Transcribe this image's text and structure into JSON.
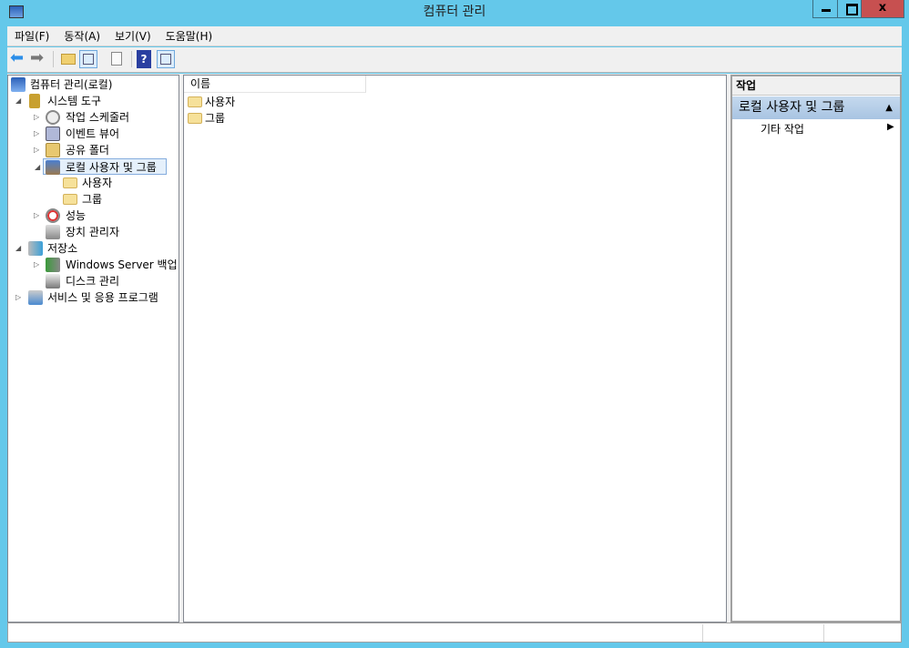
{
  "window": {
    "title": "컴퓨터 관리",
    "close_label": "x"
  },
  "menu": [
    "파일(F)",
    "동작(A)",
    "보기(V)",
    "도움말(H)"
  ],
  "tree": [
    {
      "label": "컴퓨터 관리(로컬)",
      "icon": "computer-management-icon"
    },
    {
      "label": "시스템 도구",
      "icon": "system-tools-icon"
    },
    {
      "label": "작업 스케줄러",
      "icon": "clock-icon"
    },
    {
      "label": "이벤트 뷰어",
      "icon": "event-viewer-icon"
    },
    {
      "label": "공유 폴더",
      "icon": "shared-folder-icon"
    },
    {
      "label": "로컬 사용자 및 그룹",
      "icon": "users-groups-icon"
    },
    {
      "label": "사용자",
      "icon": "folder-icon"
    },
    {
      "label": "그룹",
      "icon": "folder-icon"
    },
    {
      "label": "성능",
      "icon": "performance-icon"
    },
    {
      "label": "장치 관리자",
      "icon": "device-manager-icon"
    },
    {
      "label": "저장소",
      "icon": "storage-icon"
    },
    {
      "label": "Windows Server 백업",
      "icon": "backup-icon"
    },
    {
      "label": "디스크 관리",
      "icon": "disk-icon"
    },
    {
      "label": "서비스 및 응용 프로그램",
      "icon": "services-icon"
    }
  ],
  "list": {
    "column": "이름",
    "items": [
      "사용자",
      "그룹"
    ]
  },
  "actions": {
    "header": "작업",
    "section": "로컬 사용자 및 그룹",
    "item": "기타 작업"
  }
}
